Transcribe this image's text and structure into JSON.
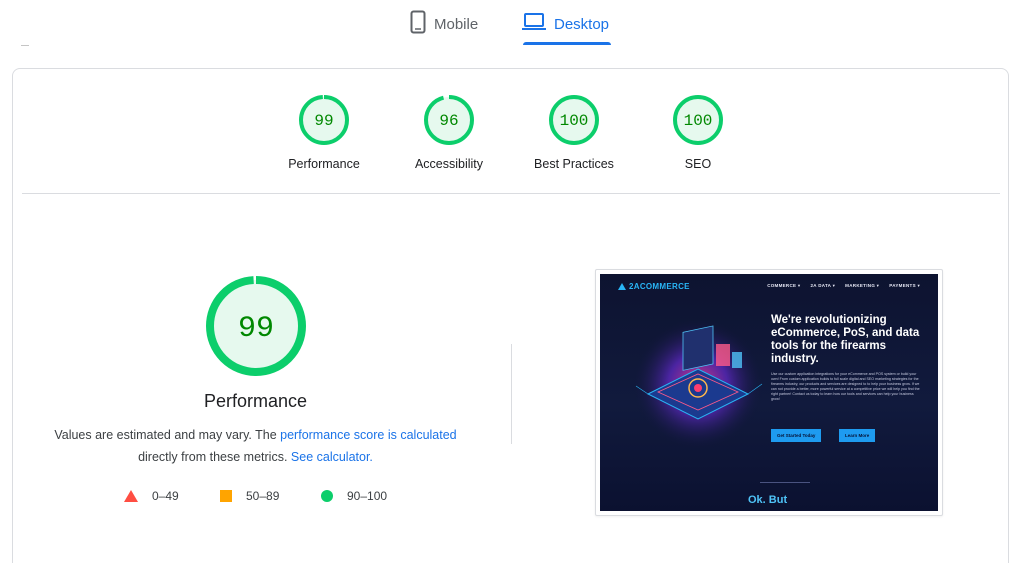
{
  "tabs": {
    "mobile_label": "Mobile",
    "desktop_label": "Desktop",
    "active": "Desktop"
  },
  "scores": [
    {
      "label": "Performance",
      "value": "99",
      "color": "#0cce6b"
    },
    {
      "label": "Accessibility",
      "value": "96",
      "color": "#0cce6b"
    },
    {
      "label": "Best Practices",
      "value": "100",
      "color": "#0cce6b"
    },
    {
      "label": "SEO",
      "value": "100",
      "color": "#0cce6b"
    }
  ],
  "main": {
    "score": "99",
    "title": "Performance",
    "desc_prefix": "Values are estimated and may vary. The ",
    "desc_link1": "performance score is calculated",
    "desc_middle": "directly from these metrics. ",
    "desc_link2": "See calculator."
  },
  "legend": [
    {
      "range": "0–49",
      "shape": "triangle-icon",
      "color": "#ff4e42"
    },
    {
      "range": "50–89",
      "shape": "square-icon",
      "color": "#ffa400"
    },
    {
      "range": "90–100",
      "shape": "circle-icon",
      "color": "#0cce6b"
    }
  ],
  "screenshot": {
    "logo": "2ACOMMERCE",
    "nav": [
      "COMMERCE ▾",
      "2A DATA ▾",
      "MARKETING ▾",
      "PAYMENTS ▾"
    ],
    "headline": "We're revolutionizing eCommerce, PoS, and data tools for the firearms industry.",
    "body": "Use our custom application integrations for your eCommerce and POS system or build your own! From custom application builds to full scale digital and SEO marketing strategies for the firearms industry, our products and services are designed to to help your business grow. If we can not provide a better, more powerful service at a competitive price we will help you find the right partner! Contact us today to learn how our tools and services can help your business grow!",
    "button1": "Get Started Today",
    "button2": "Learn More",
    "footer_text": "Ok. But"
  }
}
